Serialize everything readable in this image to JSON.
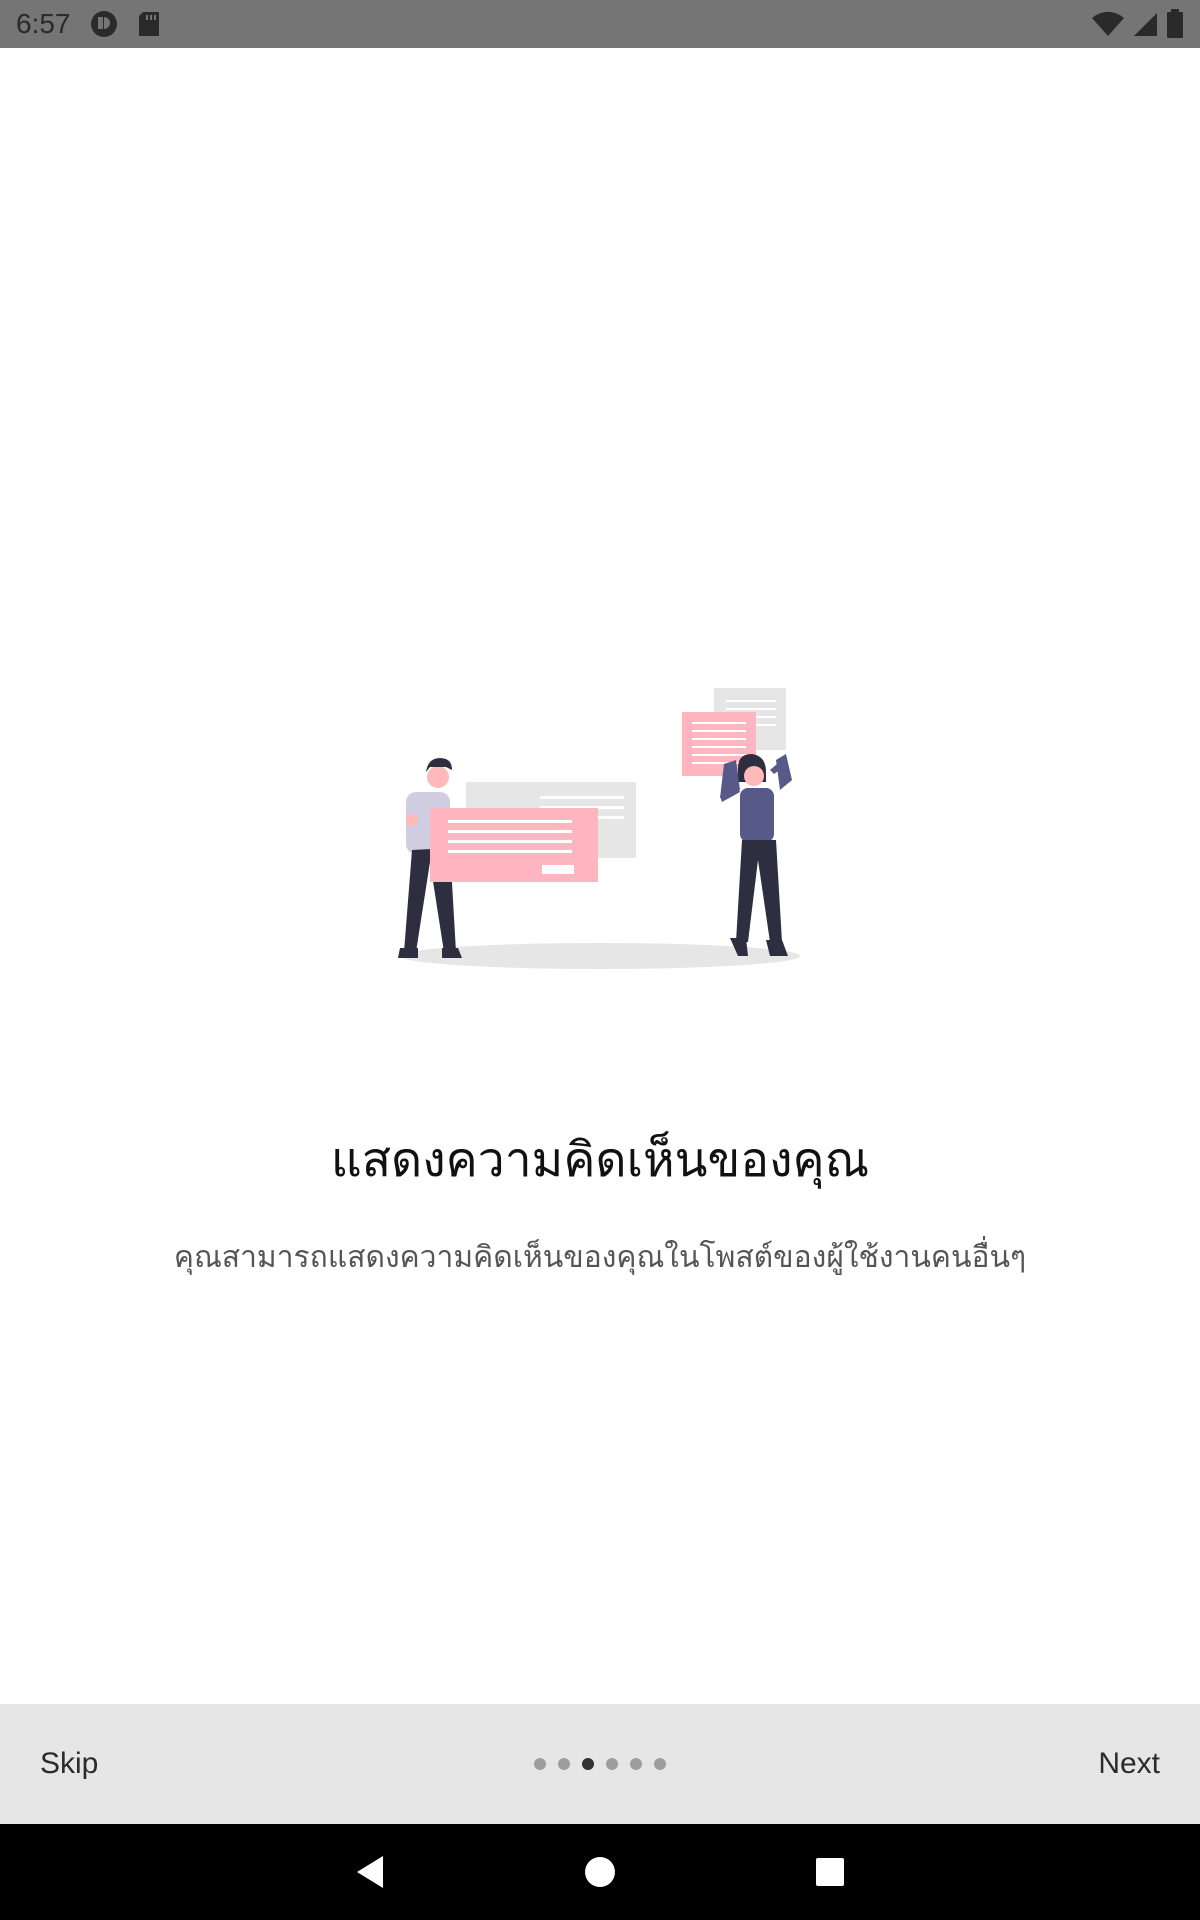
{
  "status_bar": {
    "time": "6:57",
    "icons_left": [
      "data-saver-icon",
      "sd-card-icon"
    ],
    "icons_right": [
      "wifi-icon",
      "cell-signal-icon",
      "battery-icon"
    ]
  },
  "onboarding": {
    "title": "แสดงความคิดเห็นของคุณ",
    "subtitle": "คุณสามารถแสดงความคิดเห็นของคุณในโพสต์ของผู้ใช้งานคนอื่นๆ",
    "page_indicator": {
      "total": 6,
      "current": 3
    }
  },
  "footer": {
    "skip_label": "Skip",
    "next_label": "Next"
  },
  "nav_bar": {
    "icons": [
      "back-icon",
      "home-icon",
      "recents-icon"
    ]
  },
  "colors": {
    "accent_pink": "#ffb6c1",
    "figure_purple": "#575a89",
    "figure_dark": "#2f2e41",
    "card_gray": "#e6e6e6"
  }
}
